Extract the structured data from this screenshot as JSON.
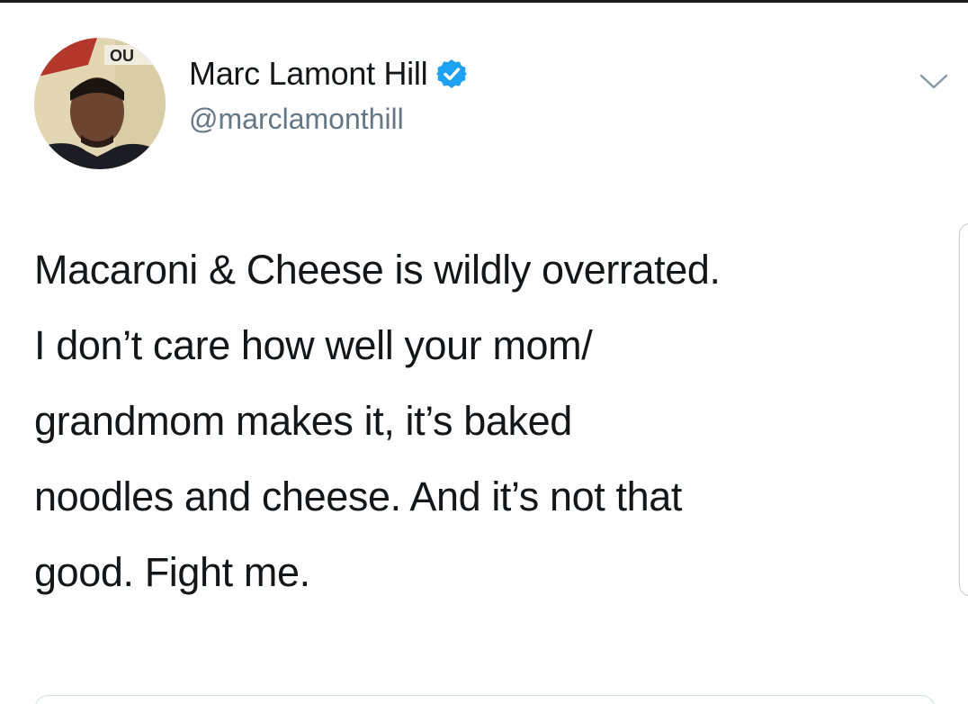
{
  "tweet": {
    "author": {
      "display_name": "Marc Lamont Hill",
      "handle": "@marclamonthill",
      "verified": true,
      "avatar_banner_text": "OU"
    },
    "text_lines": [
      "Macaroni & Cheese is wildly overrated.",
      "I don’t care how well your mom/",
      "grandmom makes it, it’s baked",
      "noodles and cheese. And it’s not that",
      "good. Fight me."
    ]
  },
  "colors": {
    "text_primary": "#14171a",
    "text_secondary": "#657786",
    "verified_blue": "#1da1f2",
    "background": "#ffffff"
  },
  "icons": {
    "verified": "verified-badge-icon",
    "menu": "chevron-down-icon"
  }
}
